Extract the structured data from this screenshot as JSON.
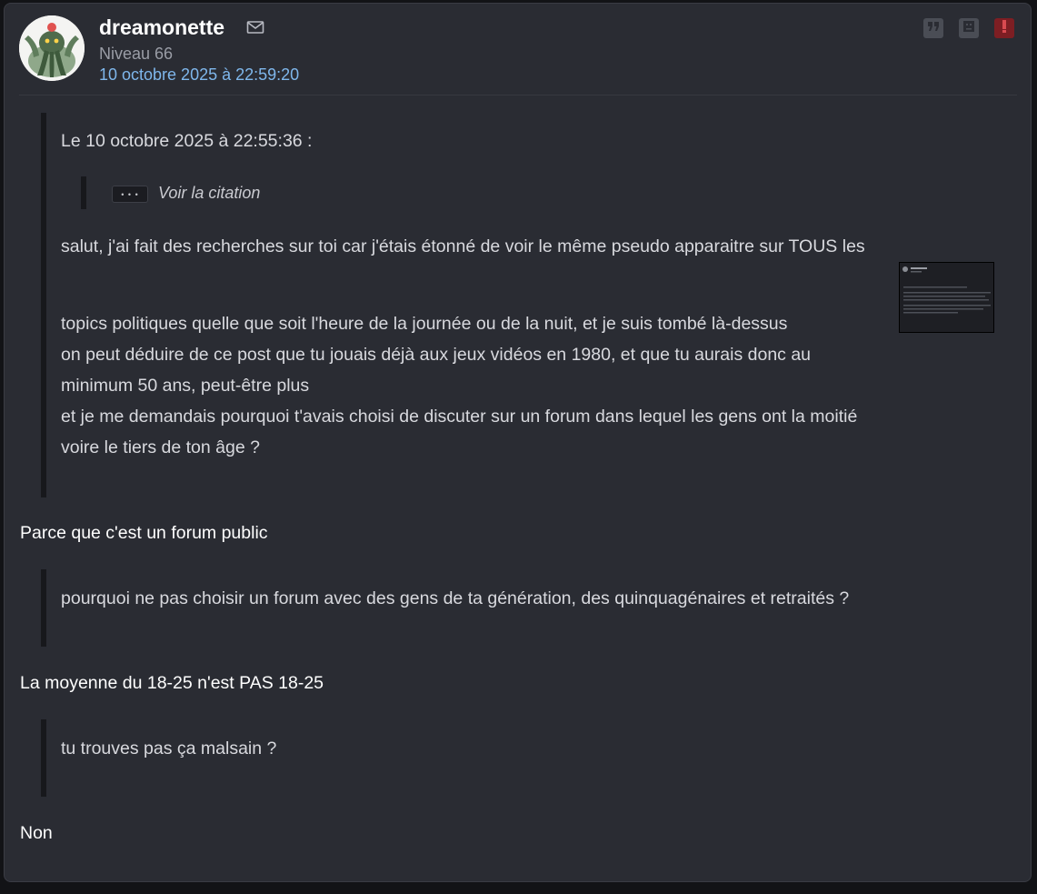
{
  "post": {
    "author": "dreamonette",
    "level": "Niveau 66",
    "date": "10 octobre 2025 à 22:59:20"
  },
  "icons": {
    "avatar": "cthulhu-avatar",
    "mail": "mail-icon",
    "quote": "quote-icon",
    "sad": "sad-face-icon",
    "report": "exclamation-icon"
  },
  "colors": {
    "background": "#2a2c33",
    "accent_link": "#7fb7ec",
    "report": "#7d1e23"
  },
  "quote": {
    "header": "Le 10 octobre 2025 à 22:55:36 :",
    "nested_dots": "• • •",
    "see_quote": "Voir la citation",
    "line1": "salut, j'ai fait des recherches sur toi car j'étais étonné de voir le même pseudo apparaitre sur TOUS les",
    "line2": "topics politiques quelle que soit l'heure de la journée ou de la nuit, et je suis tombé là-dessus",
    "line3": "on peut déduire de ce post que tu jouais déjà aux jeux vidéos en 1980, et que tu aurais donc au",
    "line4": "minimum 50 ans, peut-être plus",
    "line5": "et je me demandais pourquoi t'avais choisi de discuter sur un forum dans lequel les gens ont la moitié",
    "line6": "voire le tiers de ton âge ?"
  },
  "replies": {
    "r1": "Parce que c'est un forum public",
    "q2": "pourquoi ne pas choisir un forum avec des gens de ta génération, des quinquagénaires et retraités ?",
    "r2": "La moyenne du 18-25 n'est PAS 18-25",
    "q3": "tu trouves pas ça malsain ?",
    "r3": "Non"
  }
}
